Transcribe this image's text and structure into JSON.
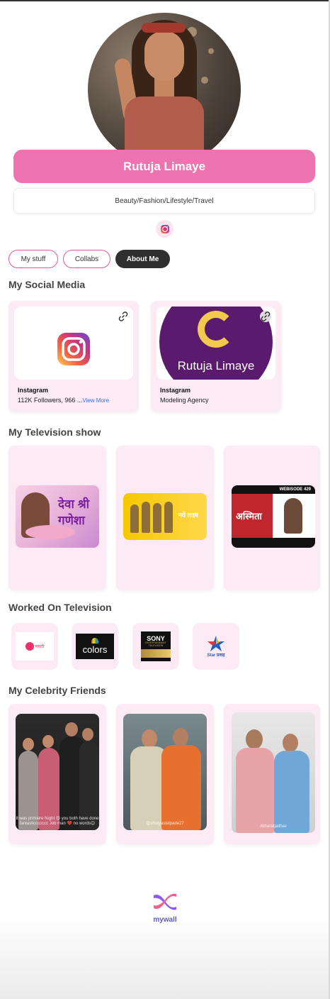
{
  "profile": {
    "name": "Rutuja Limaye",
    "category": "Beauty/Fashion/Lifestyle/Travel",
    "social_icon": "instagram-icon"
  },
  "tabs": [
    {
      "label": "My stuff",
      "active": false
    },
    {
      "label": "Collabs",
      "active": false
    },
    {
      "label": "About Me",
      "active": true
    }
  ],
  "sections": {
    "social_media": "My Social Media",
    "television_show": "My Television show",
    "worked_on_tv": "Worked On Television",
    "celebrity_friends": "My Celebrity Friends"
  },
  "social_cards": [
    {
      "platform": "Instagram",
      "description": "112K Followers, 966 ...",
      "more": "View More",
      "thumb_logo": "instagram-logo"
    },
    {
      "platform": "Instagram",
      "description": "Modeling Agency",
      "thumb_text": "Rutuja Limaye"
    }
  ],
  "tv_shows": [
    {
      "poster": "deva-shree-ganesha-poster",
      "poster_title": "देवा श्री गणेशा"
    },
    {
      "poster": "nave-lakshya-poster",
      "poster_title": "नवे लक्ष्य"
    },
    {
      "poster": "asmita-poster",
      "poster_title": "अस्मिता",
      "badge": "WEBISODE 429"
    }
  ],
  "channels": [
    {
      "name": "zee-marathi-logo",
      "label": "मराठी"
    },
    {
      "name": "colors-logo",
      "label": "colors"
    },
    {
      "name": "sony-logo",
      "label": "SONY",
      "sublabel": "ENTERTAINMENT TELEVISION"
    },
    {
      "name": "star-pravah-logo",
      "label": "Star प्रवाह"
    }
  ],
  "friends": [
    {
      "caption": "It was primiere Night 😍 you both have done fantasticcccccc Job man ❤️ no words😊"
    },
    {
      "caption": "@shreyastalpade27"
    },
    {
      "caption": "#bharatjadhav"
    }
  ],
  "brand": {
    "name": "mywall"
  },
  "colors": {
    "accent": "#ee73b1",
    "card_bg": "#fcebf5",
    "tab_border": "#e0589c",
    "active_tab": "#2f2f2f",
    "link": "#3b6fd8"
  }
}
